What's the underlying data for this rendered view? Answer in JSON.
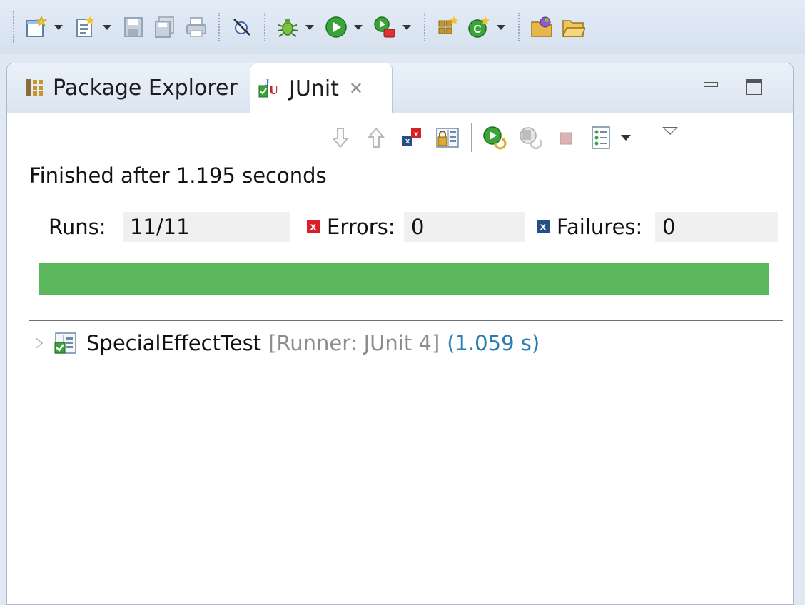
{
  "main_toolbar": {
    "items": [
      {
        "icon": "new-icon",
        "dropdown": true
      },
      {
        "icon": "new-package-icon",
        "dropdown": true
      },
      {
        "icon": "save-icon",
        "dropdown": false
      },
      {
        "icon": "save-all-icon",
        "dropdown": false
      },
      {
        "icon": "print-icon",
        "dropdown": false
      },
      {
        "icon": "skip-breakpoints-icon",
        "dropdown": false
      },
      {
        "icon": "debug-icon",
        "dropdown": true
      },
      {
        "icon": "run-icon",
        "dropdown": true
      },
      {
        "icon": "run-external-icon",
        "dropdown": true
      },
      {
        "icon": "new-java-package-icon",
        "dropdown": false
      },
      {
        "icon": "new-java-class-icon",
        "dropdown": true
      },
      {
        "icon": "open-type-icon",
        "dropdown": false
      },
      {
        "icon": "open-folder-icon",
        "dropdown": false
      }
    ]
  },
  "tabs": [
    {
      "label": "Package Explorer",
      "icon": "package-explorer-icon",
      "active": false
    },
    {
      "label": "JUnit",
      "icon": "junit-icon",
      "active": true
    }
  ],
  "junit_toolbar": {
    "icons": [
      "next-failure-icon",
      "previous-failure-icon",
      "show-failures-only-icon",
      "scroll-lock-icon",
      "rerun-icon",
      "rerun-failed-icon",
      "stop-icon",
      "history-icon"
    ]
  },
  "status": "Finished after 1.195 seconds",
  "counters": {
    "runs_label": "Runs:",
    "runs_value": "11/11",
    "errors_label": "Errors:",
    "errors_value": "0",
    "failures_label": "Failures:",
    "failures_value": "0"
  },
  "progress": {
    "fraction": 1.0,
    "color": "#5cb85c"
  },
  "tree": [
    {
      "name": "SpecialEffectTest",
      "runner": "[Runner: JUnit 4]",
      "time": "(1.059 s)"
    }
  ]
}
